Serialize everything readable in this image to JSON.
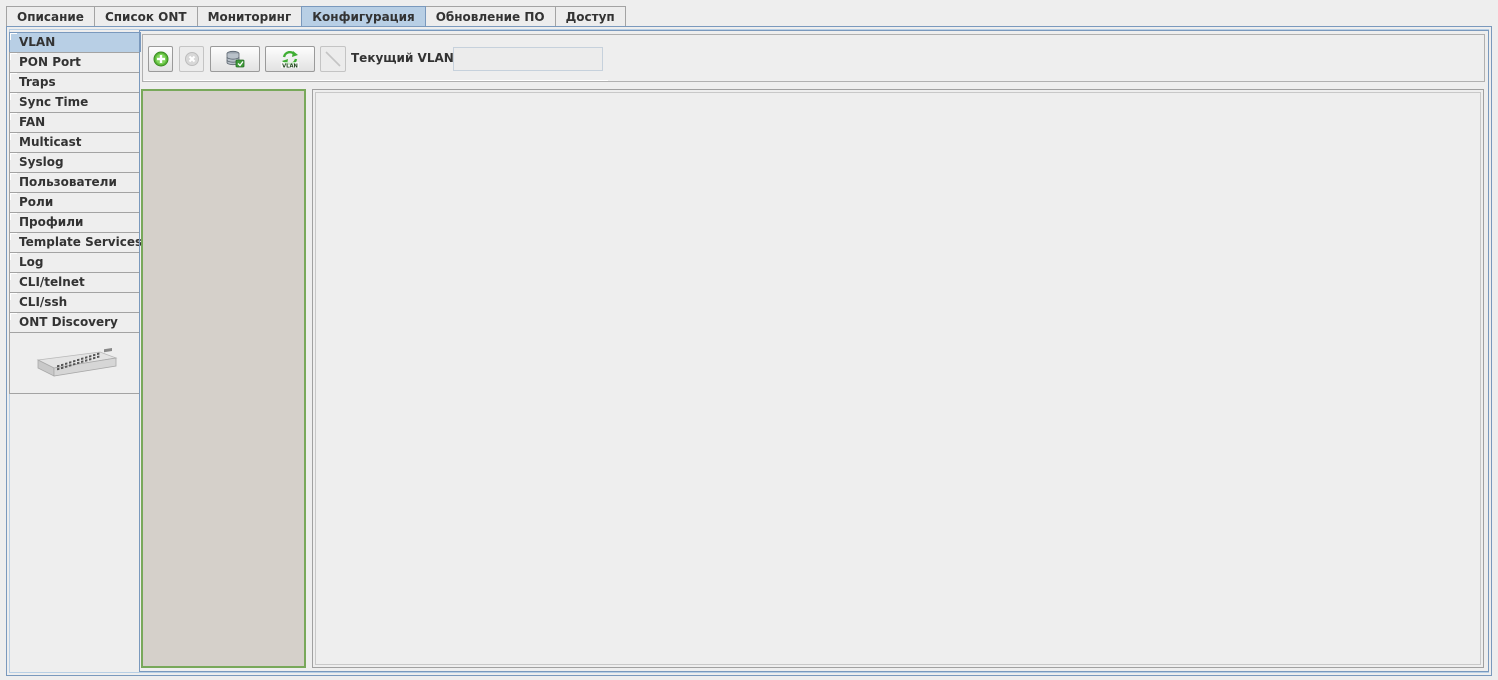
{
  "top_tabs": [
    {
      "label": "Описание",
      "active": false
    },
    {
      "label": "Список ONT",
      "active": false
    },
    {
      "label": "Мониторинг",
      "active": false
    },
    {
      "label": "Конфигурация",
      "active": true
    },
    {
      "label": "Обновление ПО",
      "active": false
    },
    {
      "label": "Доступ",
      "active": false
    }
  ],
  "side_tabs": [
    {
      "label": "VLAN",
      "active": true
    },
    {
      "label": "PON Port",
      "active": false
    },
    {
      "label": "Traps",
      "active": false
    },
    {
      "label": "Sync Time",
      "active": false
    },
    {
      "label": "FAN",
      "active": false
    },
    {
      "label": "Multicast",
      "active": false
    },
    {
      "label": "Syslog",
      "active": false
    },
    {
      "label": "Пользователи",
      "active": false
    },
    {
      "label": "Роли",
      "active": false
    },
    {
      "label": "Профили",
      "active": false
    },
    {
      "label": "Template Services",
      "active": false
    },
    {
      "label": "Log",
      "active": false
    },
    {
      "label": "CLI/telnet",
      "active": false
    },
    {
      "label": "CLI/ssh",
      "active": false
    },
    {
      "label": "ONT Discovery",
      "active": false
    }
  ],
  "toolbar": {
    "buttons": [
      {
        "icon": "add-icon",
        "enabled": true
      },
      {
        "icon": "remove-icon",
        "enabled": false
      },
      {
        "icon": "database-save-icon",
        "enabled": true
      },
      {
        "icon": "vlan-refresh-icon",
        "enabled": true
      },
      {
        "icon": "edit-icon",
        "enabled": false
      }
    ],
    "current_vlan_label": "Текущий VLAN:",
    "current_vlan_value": ""
  },
  "colors": {
    "active_tab": "#b8cfe5",
    "frame_border": "#7a99bd",
    "tree_border": "#78a85a",
    "tree_bg": "#d5d0ca",
    "background": "#eeeeee"
  }
}
